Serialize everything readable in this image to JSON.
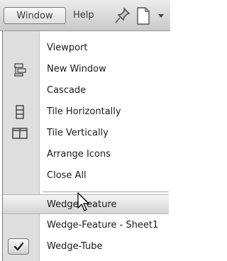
{
  "menubar": {
    "window_label": "Window",
    "help_label": "Help",
    "pin_icon": "pushpin-icon",
    "new_document_icon": "new-document-icon",
    "dropdown_icon": "dropdown-arrow-icon"
  },
  "window_menu": {
    "items": [
      {
        "label": "Viewport",
        "icon": null
      },
      {
        "label": "New Window",
        "icon": "new-window-icon"
      },
      {
        "label": "Cascade",
        "icon": null
      },
      {
        "label": "Tile Horizontally",
        "icon": "tile-horizontally-icon"
      },
      {
        "label": "Tile Vertically",
        "icon": "tile-vertically-icon"
      },
      {
        "label": "Arrange Icons",
        "icon": null
      },
      {
        "label": "Close All",
        "icon": null
      }
    ],
    "open_windows": [
      {
        "label": "Wedge-Feature",
        "highlighted": true,
        "checked": false
      },
      {
        "label": "Wedge-Feature - Sheet1",
        "highlighted": false,
        "checked": false
      },
      {
        "label": "Wedge-Tube",
        "highlighted": false,
        "checked": true
      }
    ]
  }
}
